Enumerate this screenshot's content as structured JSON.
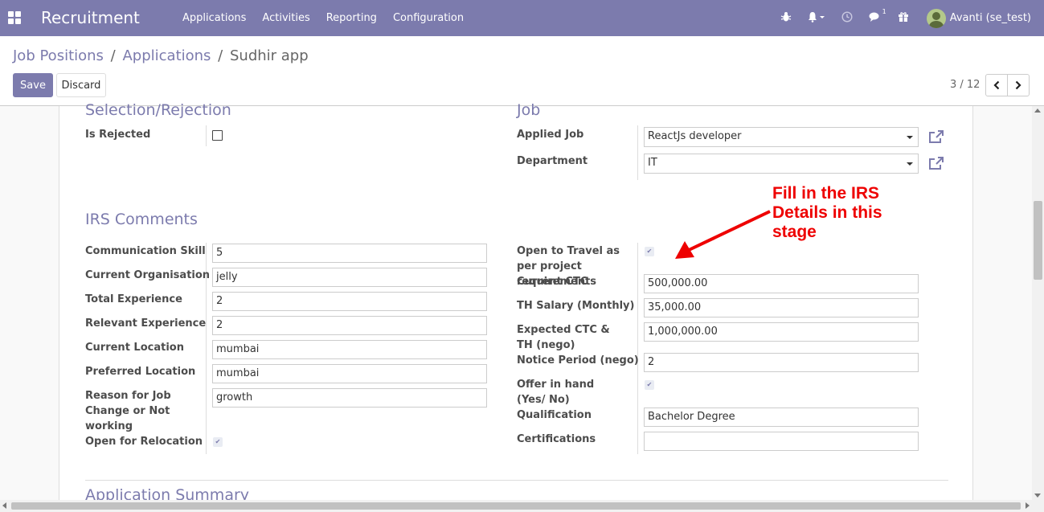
{
  "navbar": {
    "brand": "Recruitment",
    "menu": [
      "Applications",
      "Activities",
      "Reporting",
      "Configuration"
    ],
    "icons": [
      "bug-icon",
      "bell-icon",
      "clock-icon",
      "chat-icon",
      "gift-icon"
    ],
    "chat_badge": "1",
    "user": "Avanti (se_test)"
  },
  "breadcrumb": {
    "items": [
      "Job Positions",
      "Applications"
    ],
    "current": "Sudhir app",
    "separator": "/"
  },
  "buttons": {
    "save": "Save",
    "discard": "Discard"
  },
  "pager": {
    "value": "3 / 12"
  },
  "sections": {
    "selection": "Selection/Rejection",
    "job": "Job",
    "irs": "IRS Comments",
    "summary": "Application Summary"
  },
  "selection": {
    "is_rejected_label": "Is Rejected",
    "is_rejected": false
  },
  "job": {
    "applied_job_label": "Applied Job",
    "applied_job": "ReactJs developer",
    "department_label": "Department",
    "department": "IT"
  },
  "irs_left": [
    {
      "label": "Communication Skill",
      "value": "5"
    },
    {
      "label": "Current Organisation",
      "value": "jelly"
    },
    {
      "label": "Total Experience",
      "value": "2"
    },
    {
      "label": "Relevant Experience",
      "value": "2"
    },
    {
      "label": "Current Location",
      "value": "mumbai"
    },
    {
      "label": "Preferred Location",
      "value": "mumbai"
    },
    {
      "label": "Reason for Job Change or Not working",
      "value": "growth"
    }
  ],
  "relocation": {
    "label": "Open for Relocation",
    "checked": true
  },
  "irs_right": {
    "travel_label": "Open to Travel as per project requirements",
    "travel_checked": true,
    "current_ctc_label": "Current CTC",
    "current_ctc": "500,000.00",
    "th_salary_label": "TH Salary (Monthly)",
    "th_salary": "35,000.00",
    "expected_ctc_label": "Expected CTC & TH (nego)",
    "expected_ctc": "1,000,000.00",
    "notice_label": "Notice Period (nego)",
    "notice": "2",
    "offer_label": "Offer in hand (Yes/ No)",
    "offer_checked": true,
    "qualification_label": "Qualification",
    "qualification": "Bachelor Degree",
    "certifications_label": "Certifications",
    "certifications": ""
  },
  "annotation": {
    "lines": [
      "Fill in the IRS",
      "Details in this",
      "stage"
    ],
    "color": "#ee0000"
  },
  "colors": {
    "primary": "#7c7bad",
    "annotation": "#ee0000"
  }
}
